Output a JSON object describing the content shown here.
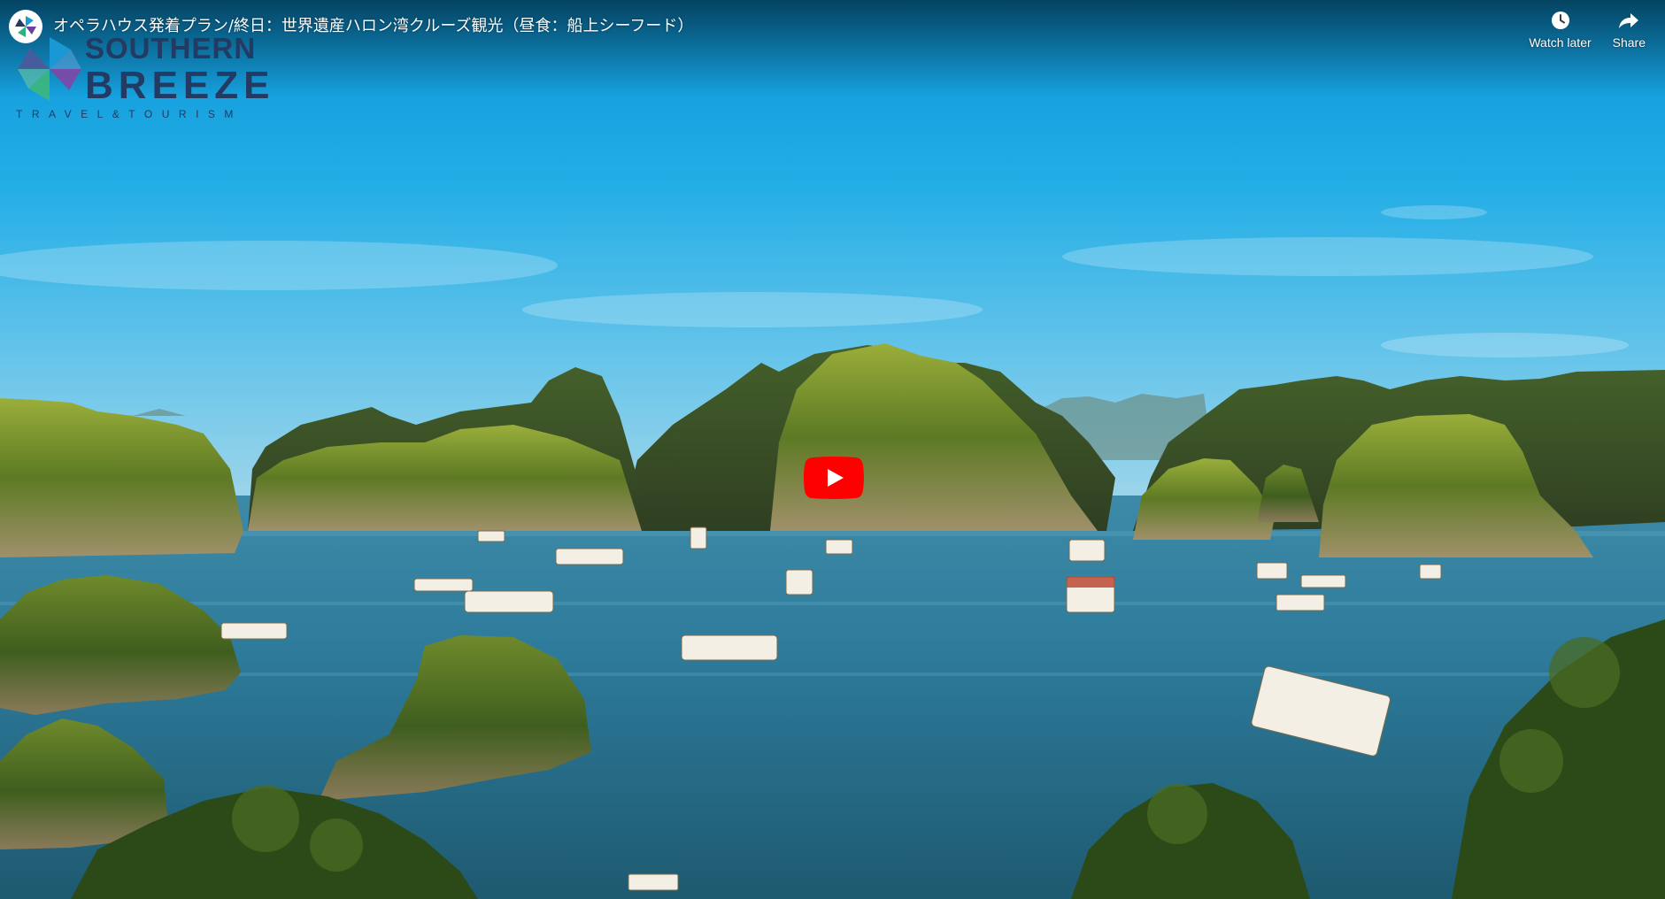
{
  "video": {
    "title": "オペラハウス発着プラン/終日：世界遺産ハロン湾クルーズ観光（昼食：船上シーフード）"
  },
  "channel": {
    "avatar_icon": "pinwheel-logo-icon"
  },
  "actions": {
    "watch_later_label": "Watch later",
    "watch_later_icon": "clock-icon",
    "share_label": "Share",
    "share_icon": "share-arrow-icon"
  },
  "brand": {
    "name_line1": "SOUTHERN",
    "name_line2": "BREEZE",
    "tagline": "TRAVEL&TOURISM",
    "text_color": "#233a62"
  },
  "player": {
    "play_icon": "youtube-play-icon",
    "play_color": "#ff0000"
  }
}
